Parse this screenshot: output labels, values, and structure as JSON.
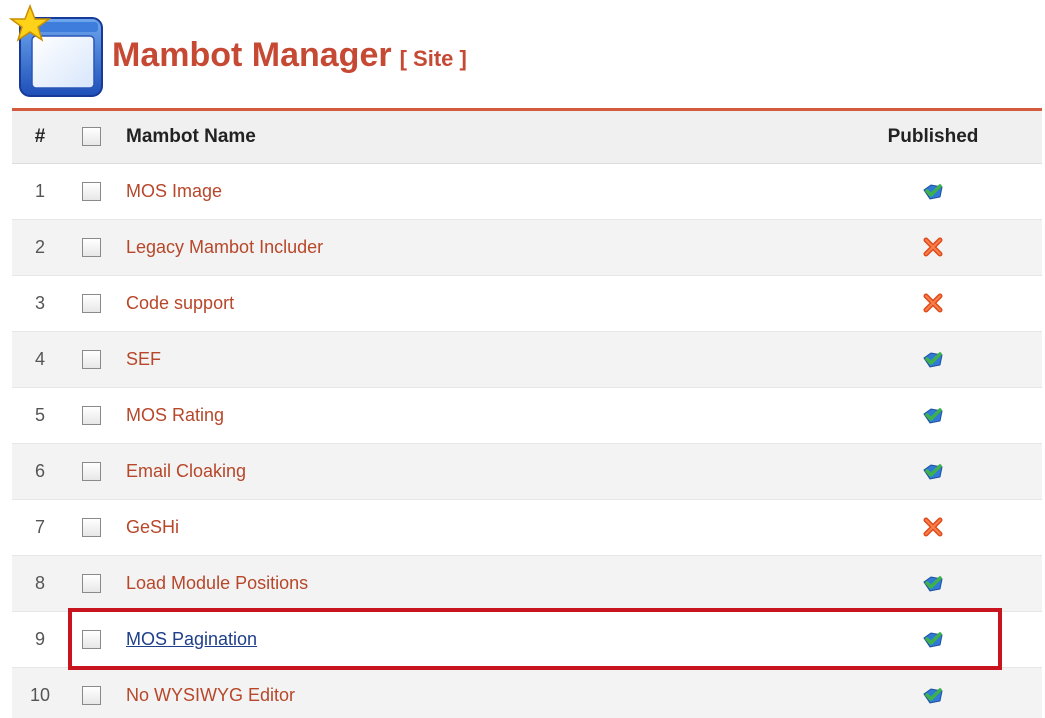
{
  "header": {
    "title": "Mambot Manager",
    "subtitle": "[ Site ]",
    "icon": "mambot-manager-icon"
  },
  "table": {
    "columns": {
      "num": "#",
      "name": "Mambot Name",
      "published": "Published"
    },
    "rows": [
      {
        "num": "1",
        "name": "MOS Image",
        "published": true
      },
      {
        "num": "2",
        "name": "Legacy Mambot Includer",
        "published": false
      },
      {
        "num": "3",
        "name": "Code support",
        "published": false
      },
      {
        "num": "4",
        "name": "SEF",
        "published": true
      },
      {
        "num": "5",
        "name": "MOS Rating",
        "published": true
      },
      {
        "num": "6",
        "name": "Email Cloaking",
        "published": true
      },
      {
        "num": "7",
        "name": "GeSHi",
        "published": false
      },
      {
        "num": "8",
        "name": "Load Module Positions",
        "published": true
      },
      {
        "num": "9",
        "name": "MOS Pagination",
        "published": true,
        "highlighted": true
      },
      {
        "num": "10",
        "name": "No WYSIWYG Editor",
        "published": true
      }
    ]
  },
  "icons": {
    "published": "published-check-icon",
    "unpublished": "unpublished-x-icon"
  },
  "colors": {
    "title": "#c64934",
    "link": "#b7472a",
    "active_link": "#1e3f8a",
    "highlight_border": "#c8141f",
    "unpublished": "#e04a1a"
  }
}
